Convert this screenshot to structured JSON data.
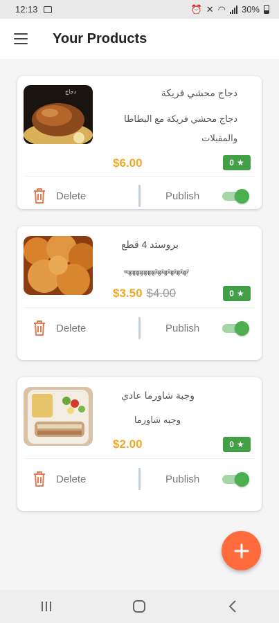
{
  "status_bar": {
    "time": "12:13",
    "battery": "30%"
  },
  "app_bar": {
    "title": "Your Products"
  },
  "products": [
    {
      "name": "دجاج محشي فريكة",
      "description": "دجاج محشي فريكة مع البطاطا والمقبلات",
      "price": "$6.00",
      "old_price": "",
      "rating": "0",
      "delete_label": "Delete",
      "publish_label": "Publish",
      "published": true
    },
    {
      "name": "بروستد 4 قطع",
      "description": "تهتهتهتهتهتهههههههه",
      "price": "$3.50",
      "old_price": "$4.00",
      "rating": "0",
      "delete_label": "Delete",
      "publish_label": "Publish",
      "published": true
    },
    {
      "name": "وجبة شاورما عادي",
      "description": "وجبه شاورما",
      "price": "$2.00",
      "old_price": "",
      "rating": "0",
      "delete_label": "Delete",
      "publish_label": "Publish",
      "published": true
    }
  ],
  "colors": {
    "accent": "#ff6b3d",
    "price": "#f5a623",
    "rating": "#43a047",
    "toggle_on": "#4caf50"
  }
}
